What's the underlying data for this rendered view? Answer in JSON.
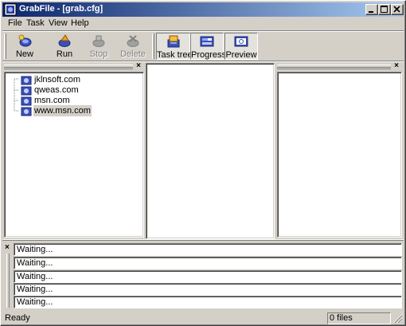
{
  "window": {
    "title": "GrabFile - [grab.cfg]",
    "icon": "grabfile-app-icon",
    "controls": [
      "minimize-icon",
      "maximize-icon",
      "close-icon"
    ]
  },
  "menu": {
    "items": [
      "File",
      "Task",
      "View",
      "Help"
    ]
  },
  "toolbar": {
    "buttons": [
      {
        "label": "New",
        "icon": "new-task-icon",
        "enabled": true
      },
      {
        "label": "Run",
        "icon": "run-icon",
        "enabled": true
      },
      {
        "label": "Stop",
        "icon": "stop-icon",
        "enabled": false
      },
      {
        "label": "Delete",
        "icon": "delete-icon",
        "enabled": false
      }
    ],
    "view_buttons": [
      {
        "label": "Task tree",
        "icon": "task-tree-icon",
        "pressed": true
      },
      {
        "label": "Progress",
        "icon": "progress-icon",
        "pressed": true
      },
      {
        "label": "Preview",
        "icon": "preview-icon",
        "pressed": true
      }
    ]
  },
  "tree": {
    "items": [
      {
        "label": "jklnsoft.com",
        "icon": "site-icon",
        "selected": false
      },
      {
        "label": "qweas.com",
        "icon": "site-icon",
        "selected": false
      },
      {
        "label": "msn.com",
        "icon": "site-icon",
        "selected": false
      },
      {
        "label": "www.msn.com",
        "icon": "site-icon",
        "selected": true
      }
    ]
  },
  "log": {
    "rows": [
      "Waiting...",
      "Waiting...",
      "Waiting...",
      "Waiting...",
      "Waiting..."
    ]
  },
  "status": {
    "left": "Ready",
    "files": "0 files"
  },
  "colors": {
    "titlebar_start": "#0a246a",
    "titlebar_end": "#a6caf0",
    "face": "#d4d0c8"
  }
}
